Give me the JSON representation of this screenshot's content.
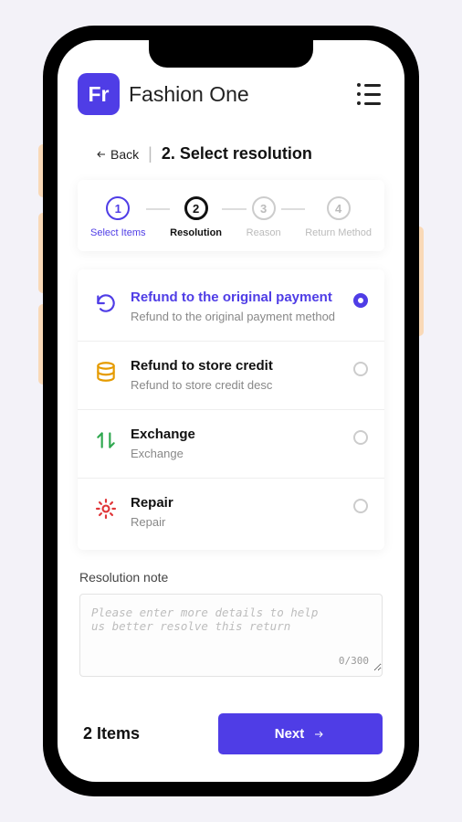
{
  "header": {
    "logo_text": "Fr",
    "brand_name": "Fashion One"
  },
  "title_bar": {
    "back_label": "Back",
    "page_title": "2. Select resolution"
  },
  "stepper": {
    "steps": [
      {
        "num": "1",
        "label": "Select Items",
        "state": "done"
      },
      {
        "num": "2",
        "label": "Resolution",
        "state": "current"
      },
      {
        "num": "3",
        "label": "Reason",
        "state": "future"
      },
      {
        "num": "4",
        "label": "Return Method",
        "state": "future"
      }
    ]
  },
  "options": [
    {
      "icon": "refresh-icon",
      "icon_color": "#4f3de6",
      "title": "Refund to the original payment",
      "desc": "Refund to the original payment method",
      "selected": true
    },
    {
      "icon": "coins-icon",
      "icon_color": "#e59b00",
      "title": "Refund to store credit",
      "desc": "Refund to store credit desc",
      "selected": false
    },
    {
      "icon": "exchange-icon",
      "icon_color": "#2fa84f",
      "title": "Exchange",
      "desc": "Exchange",
      "selected": false
    },
    {
      "icon": "repair-icon",
      "icon_color": "#e0373a",
      "title": "Repair",
      "desc": "Repair",
      "selected": false
    }
  ],
  "note": {
    "label": "Resolution note",
    "placeholder": "Please enter more details to help us better resolve this return",
    "value": "",
    "counter": "0/300"
  },
  "footer": {
    "item_count": "2 Items",
    "next_label": "Next"
  }
}
